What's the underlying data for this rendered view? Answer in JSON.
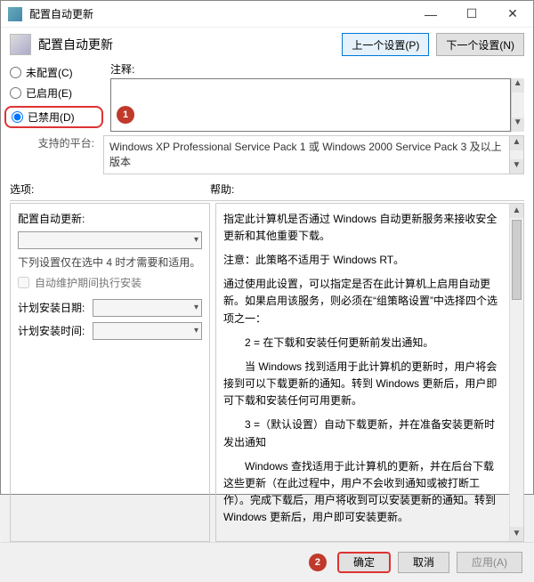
{
  "window": {
    "title": "配置自动更新"
  },
  "winbuttons": {
    "minimize": "—",
    "maximize": "☐",
    "close": "✕"
  },
  "header": {
    "title": "配置自动更新",
    "prev_setting": "上一个设置(P)",
    "next_setting": "下一个设置(N)"
  },
  "radios": {
    "not_configured": "未配置(C)",
    "enabled": "已启用(E)",
    "disabled": "已禁用(D)"
  },
  "comment": {
    "label": "注释:",
    "value": ""
  },
  "supported": {
    "label": "支持的平台:",
    "text": "Windows XP Professional Service Pack 1 或 Windows 2000 Service Pack 3 及以上版本"
  },
  "columns": {
    "options_label": "选项:",
    "help_label": "帮助:"
  },
  "options": {
    "config_update_label": "配置自动更新:",
    "note": "下列设置仅在选中 4 时才需要和适用。",
    "maintenance_checkbox": "自动维护期间执行安装",
    "install_date_label": "计划安装日期:",
    "install_time_label": "计划安装时间:"
  },
  "help": {
    "p1": "指定此计算机是否通过 Windows 自动更新服务来接收安全更新和其他重要下载。",
    "p2": "注意：此策略不适用于 Windows RT。",
    "p3": "通过使用此设置，可以指定是否在此计算机上启用自动更新。如果启用该服务，则必须在“组策略设置”中选择四个选项之一：",
    "p4": "　　2 = 在下载和安装任何更新前发出通知。",
    "p5": "　　当 Windows 找到适用于此计算机的更新时，用户将会接到可以下载更新的通知。转到 Windows 更新后，用户即可下载和安装任何可用更新。",
    "p6": "　　3 =（默认设置）自动下载更新，并在准备安装更新时发出通知",
    "p7": "　　Windows 查找适用于此计算机的更新，并在后台下载这些更新（在此过程中，用户不会收到通知或被打断工作）。完成下载后，用户将收到可以安装更新的通知。转到 Windows 更新后，用户即可安装更新。"
  },
  "footer": {
    "ok": "确定",
    "cancel": "取消",
    "apply": "应用(A)"
  },
  "badges": {
    "one": "1",
    "two": "2"
  }
}
